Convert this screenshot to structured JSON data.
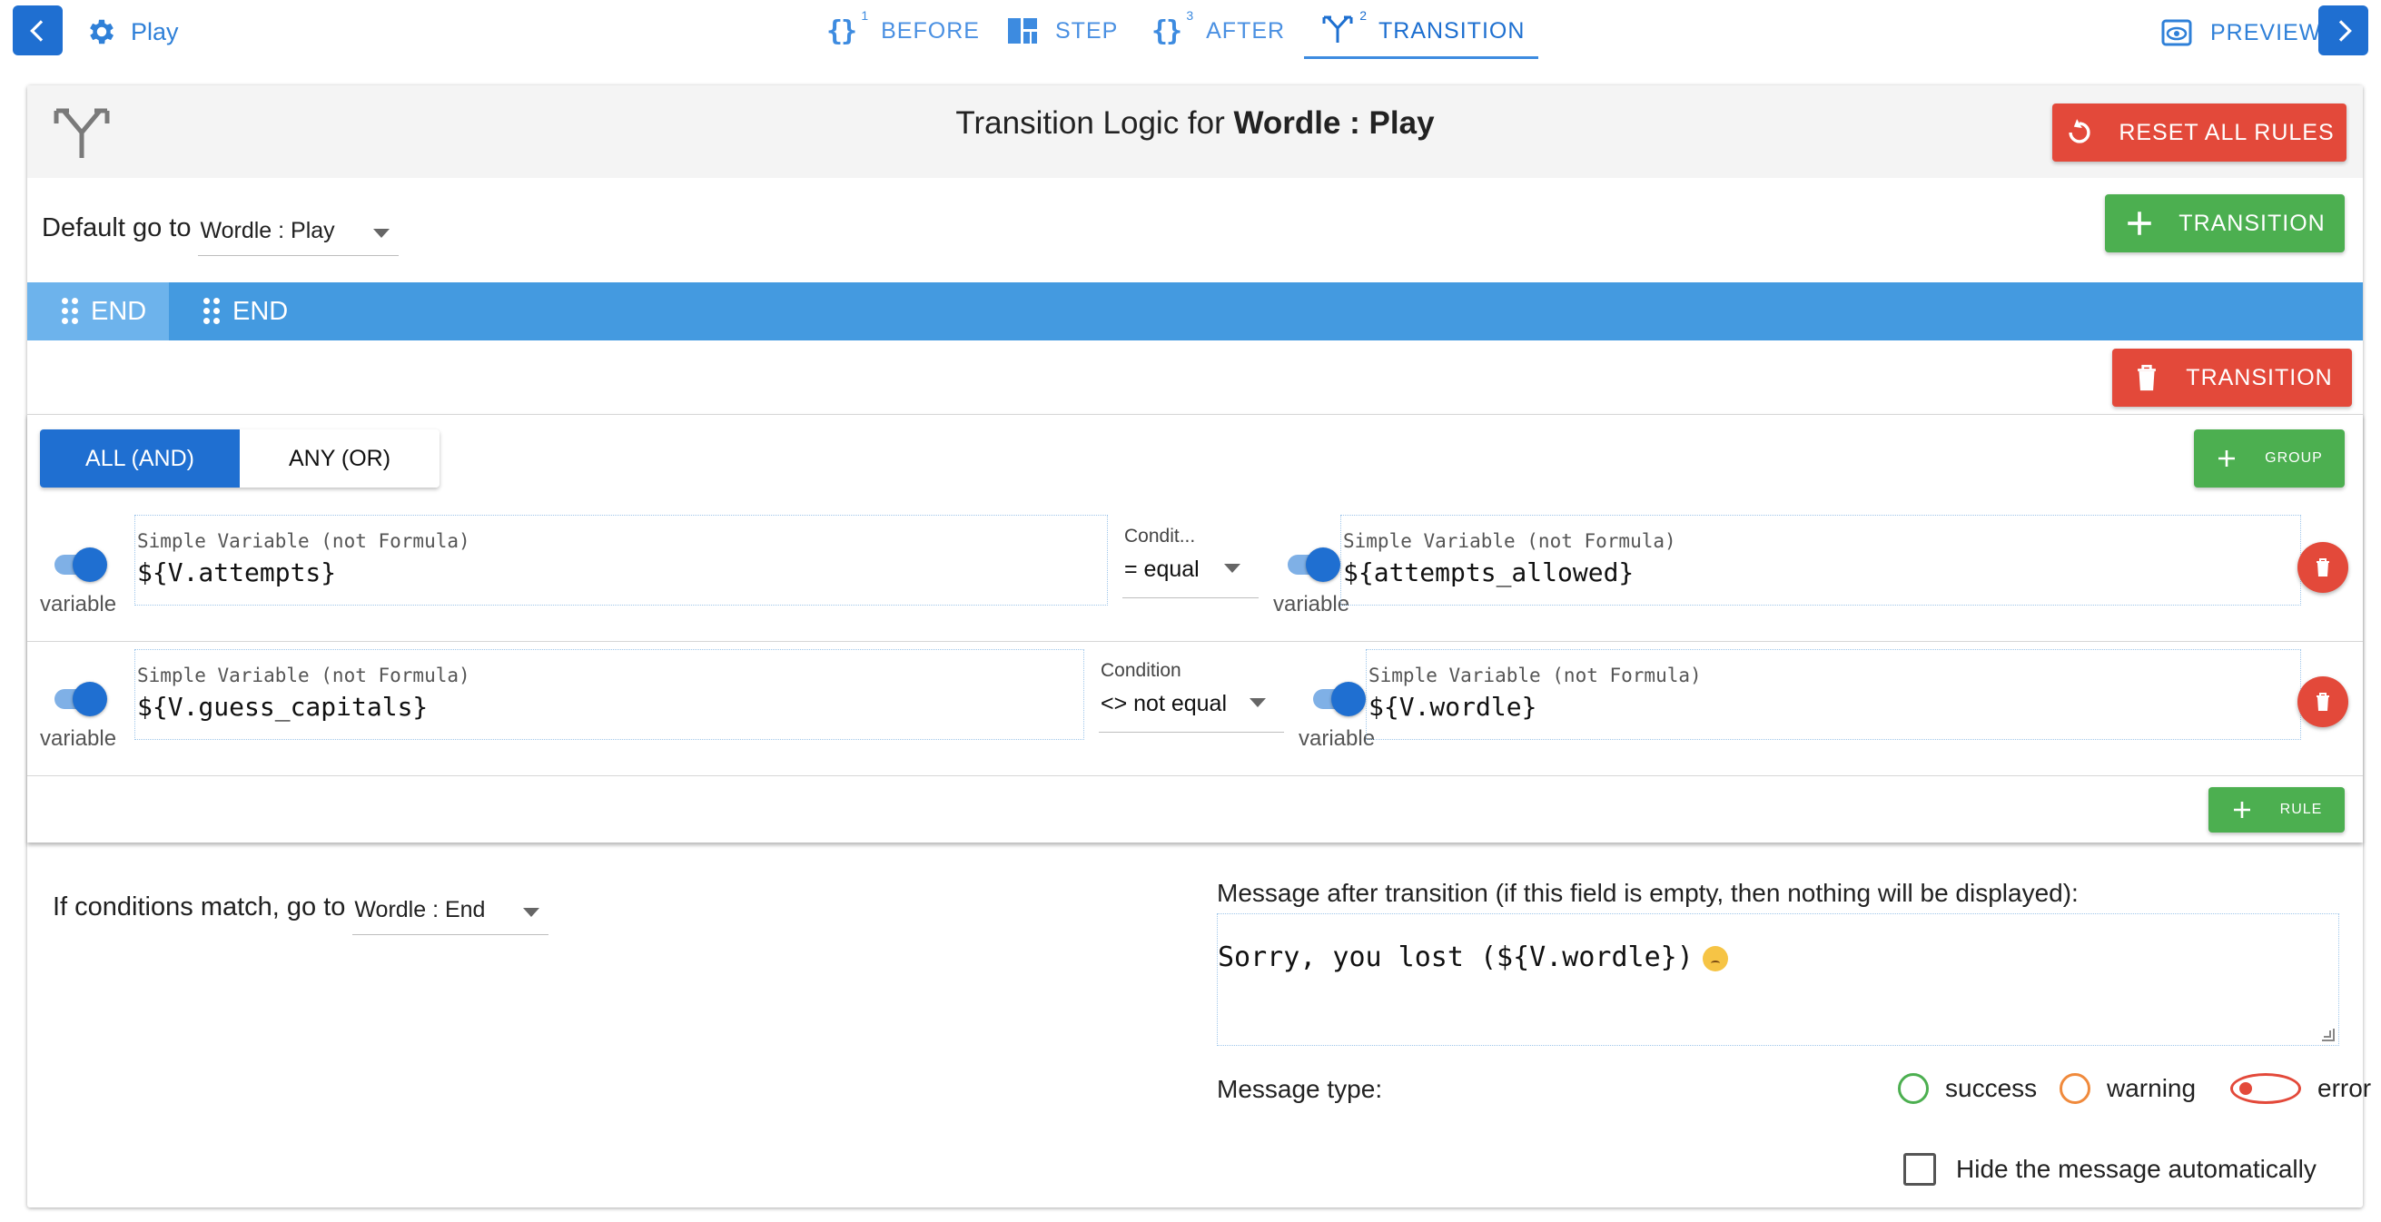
{
  "nav": {
    "play_label": "Play",
    "tabs": [
      {
        "icon": "{}",
        "num": "1",
        "label": "BEFORE"
      },
      {
        "icon": "grid",
        "label": "STEP"
      },
      {
        "icon": "{}",
        "num": "3",
        "label": "AFTER"
      },
      {
        "icon": "split",
        "num": "2",
        "label": "TRANSITION"
      }
    ],
    "preview_label": "PREVIEW",
    "accent": "#1f6fd1"
  },
  "header": {
    "title_prefix": "Transition Logic for ",
    "title_bold": "Wordle : Play",
    "reset_label": "RESET ALL RULES"
  },
  "default_row": {
    "label": "Default go to",
    "value": "Wordle : Play",
    "add_transition_label": "TRANSITION"
  },
  "end_tabs": [
    {
      "label": "END"
    },
    {
      "label": "END"
    }
  ],
  "delete_transition_label": "TRANSITION",
  "logic": {
    "all_label": "ALL (AND)",
    "any_label": "ANY (OR)",
    "group_label": "GROUP",
    "rule_label": "RULE"
  },
  "rules": [
    {
      "left_toggle_label": "variable",
      "left_field_label": "Simple Variable (not Formula)",
      "left_value": "${V.attempts}",
      "condition_label": "Condit...",
      "condition_value": "= equal",
      "right_toggle_label": "variable",
      "right_field_label": "Simple Variable (not Formula)",
      "right_value": "${attempts_allowed}"
    },
    {
      "left_toggle_label": "variable",
      "left_field_label": "Simple Variable (not Formula)",
      "left_value": "${V.guess_capitals}",
      "condition_label": "Condition",
      "condition_value": "<> not equal",
      "right_toggle_label": "variable",
      "right_field_label": "Simple Variable (not Formula)",
      "right_value": "${V.wordle}"
    }
  ],
  "match": {
    "label": "If conditions match, go to",
    "value": "Wordle : End"
  },
  "message": {
    "label": "Message after transition (if this field is empty, then nothing will be displayed):",
    "text": "Sorry, you lost (${V.wordle})",
    "emoji": "crying-face",
    "type_label": "Message type:",
    "types": [
      {
        "label": "success",
        "color": "#4caf50",
        "selected": false
      },
      {
        "label": "warning",
        "color": "#f08a3c",
        "selected": false
      },
      {
        "label": "error",
        "color": "#e3493a",
        "selected": true
      }
    ],
    "hide_label": "Hide the message automatically",
    "hide_checked": false
  },
  "colors": {
    "primary": "#1f6fd1",
    "danger": "#e3493a",
    "success": "#4caf50",
    "tab_bar": "#449ae0"
  }
}
